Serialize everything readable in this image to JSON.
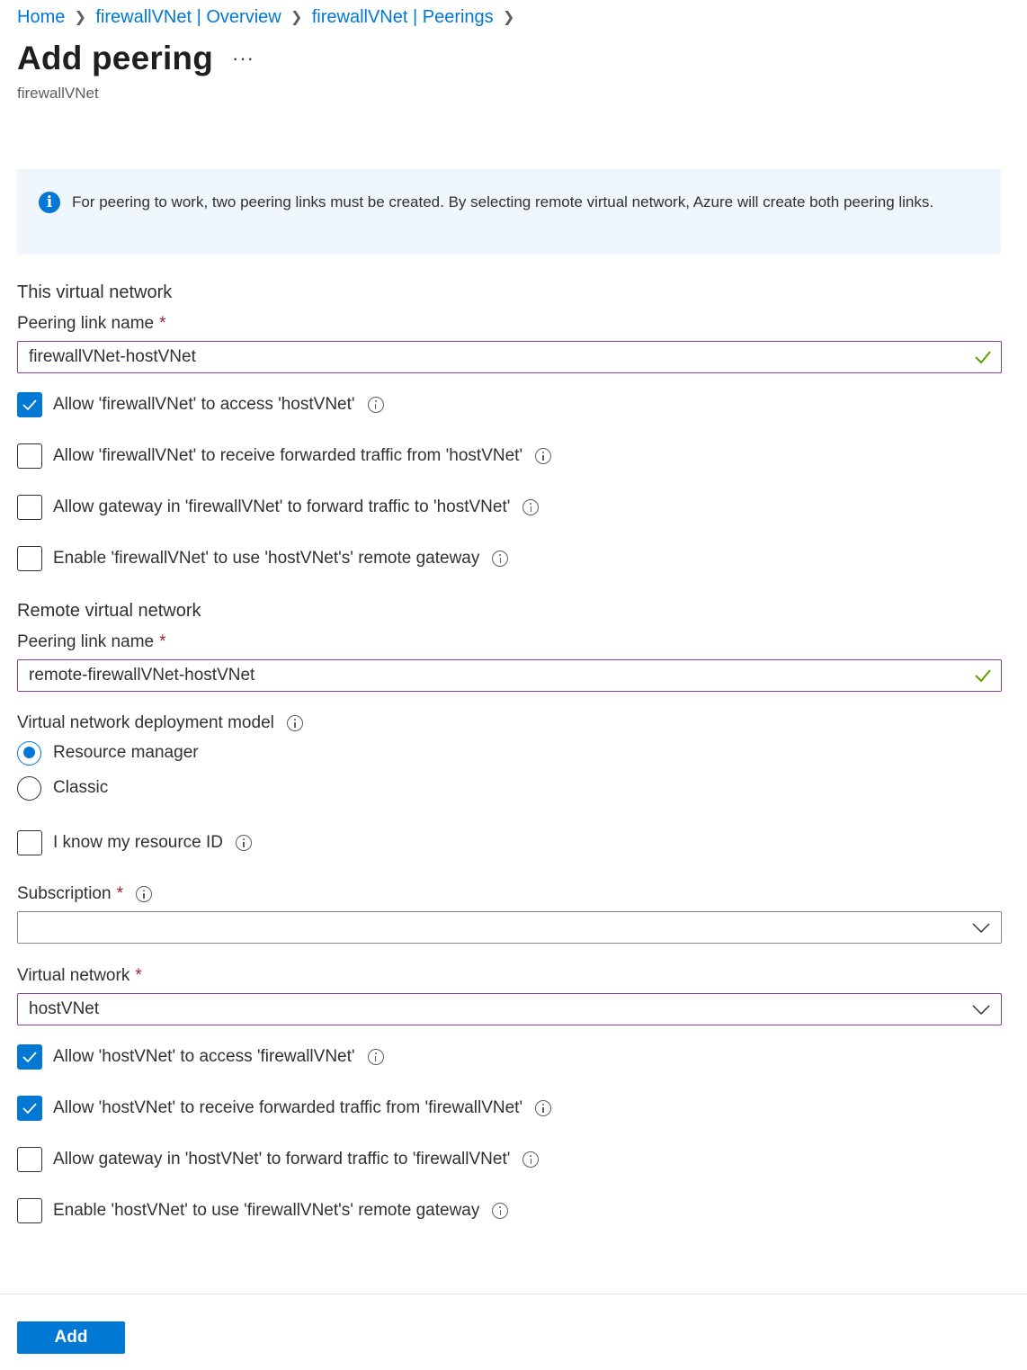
{
  "breadcrumb": [
    {
      "label": "Home"
    },
    {
      "label": "firewallVNet | Overview"
    },
    {
      "label": "firewallVNet | Peerings"
    }
  ],
  "breadcrumb_separator": ">",
  "header": {
    "title": "Add peering",
    "more_label": "···",
    "subtitle": "firewallVNet"
  },
  "info_banner": {
    "icon": "info-icon",
    "text": "For peering to work, two peering links must be created. By selecting remote virtual network, Azure will create both peering links."
  },
  "this_network": {
    "section_title": "This virtual network",
    "peering_link_name": {
      "label": "Peering link name",
      "required_mark": "*",
      "value": "firewallVNet-hostVNet",
      "valid": true
    },
    "options": [
      {
        "label": "Allow 'firewallVNet' to access 'hostVNet'",
        "checked": true
      },
      {
        "label": "Allow 'firewallVNet' to receive forwarded traffic from 'hostVNet'",
        "checked": false
      },
      {
        "label": "Allow gateway in 'firewallVNet' to forward traffic to 'hostVNet'",
        "checked": false
      },
      {
        "label": "Enable 'firewallVNet' to use 'hostVNet's' remote gateway",
        "checked": false
      }
    ]
  },
  "remote_network": {
    "section_title": "Remote virtual network",
    "peering_link_name": {
      "label": "Peering link name",
      "required_mark": "*",
      "value": "remote-firewallVNet-hostVNet",
      "valid": true
    },
    "deployment_model": {
      "label": "Virtual network deployment model",
      "options": [
        {
          "label": "Resource manager",
          "selected": true
        },
        {
          "label": "Classic",
          "selected": false
        }
      ]
    },
    "know_resource_id": {
      "label": "I know my resource ID",
      "checked": false
    },
    "subscription": {
      "label": "Subscription",
      "required_mark": "*",
      "value": ""
    },
    "virtual_network": {
      "label": "Virtual network",
      "required_mark": "*",
      "value": "hostVNet"
    },
    "options": [
      {
        "label": "Allow 'hostVNet' to access 'firewallVNet'",
        "checked": true
      },
      {
        "label": "Allow 'hostVNet' to receive forwarded traffic from 'firewallVNet'",
        "checked": true
      },
      {
        "label": "Allow gateway in 'hostVNet' to forward traffic to 'firewallVNet'",
        "checked": false
      },
      {
        "label": "Enable 'hostVNet' to use 'firewallVNet's' remote gateway",
        "checked": false
      }
    ]
  },
  "footer": {
    "add_label": "Add"
  },
  "colors": {
    "accent": "#0078d4",
    "focus_border": "#8a3c9c",
    "valid_check": "#57a300",
    "required": "#a4262c",
    "info_bg": "#eff6fc"
  }
}
